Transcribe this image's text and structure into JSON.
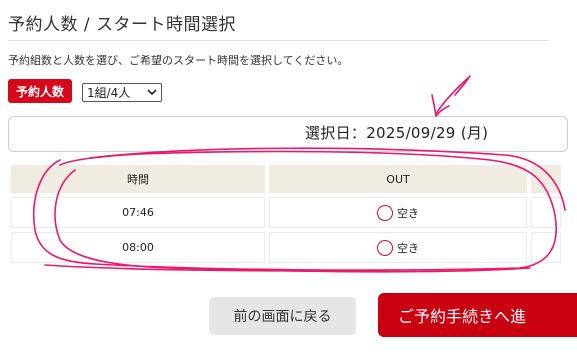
{
  "page": {
    "title": "予約人数 / スタート時間選択",
    "instruction": "予約組数と人数を選び、ご希望のスタート時間を選択してください。"
  },
  "party": {
    "label": "予約人数",
    "selected": "1組/4人"
  },
  "date": {
    "text": "選択日：2025/09/29 (月)"
  },
  "table": {
    "headers": [
      "時間",
      "OUT"
    ],
    "rows": [
      {
        "time": "07:46",
        "status": "空き"
      },
      {
        "time": "08:00",
        "status": "空き"
      }
    ]
  },
  "buttons": {
    "back": "前の画面に戻る",
    "next": "ご予約手続きへ進"
  },
  "colors": {
    "accent": "#d6071b",
    "annotation": "#e8196e"
  }
}
